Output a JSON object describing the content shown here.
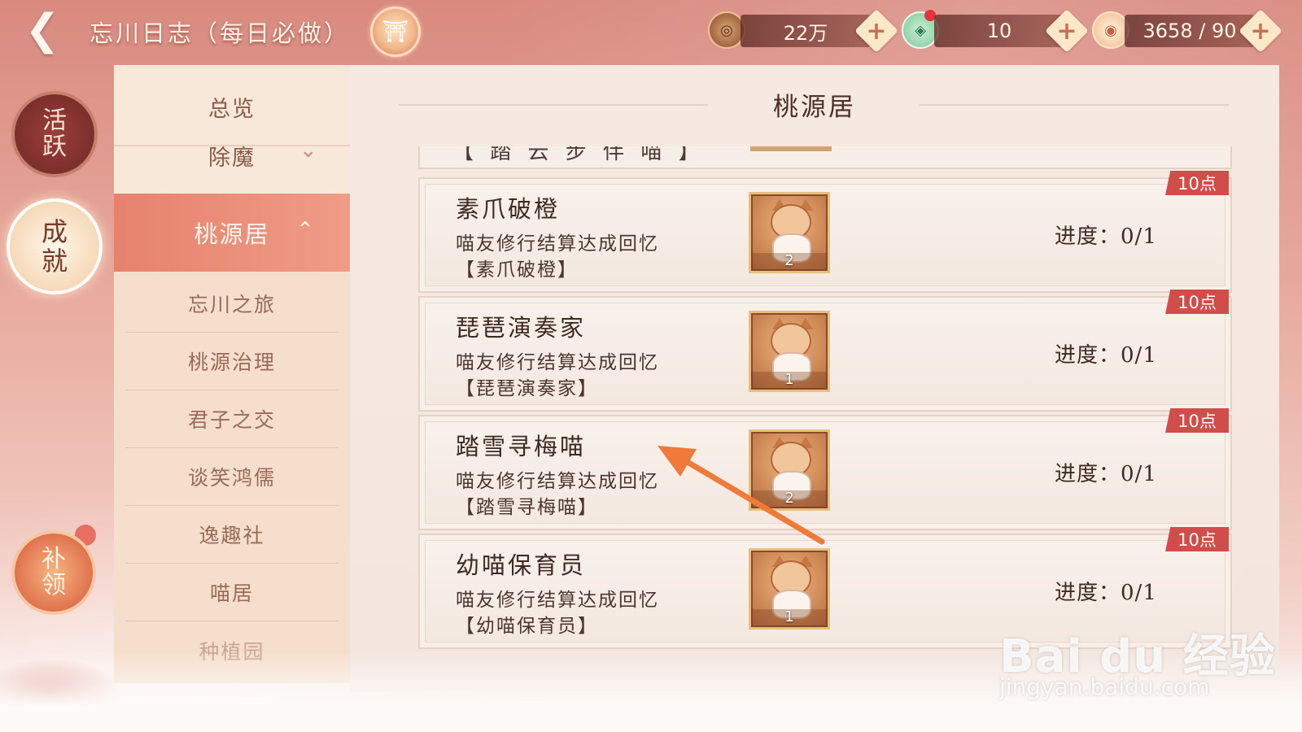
{
  "header": {
    "back_icon": "back-arrow-icon",
    "title": "忘川日志（每日必做）",
    "emblem_icon": "pavilion-emblem-icon"
  },
  "resources": [
    {
      "icon": "copper-coin-icon",
      "value": "22万"
    },
    {
      "icon": "jade-token-icon",
      "value": "10"
    },
    {
      "icon": "rice-bowl-icon",
      "value": "3658 / 90"
    }
  ],
  "side_tabs": {
    "active": "活跃",
    "achievement": "成就",
    "claim": "补领"
  },
  "nav": {
    "overview": "总览",
    "exorcism": "除魔",
    "selected": "桃源居",
    "sub_items": [
      "忘川之旅",
      "桃源治理",
      "君子之交",
      "谈笑鸿儒",
      "逸趣社",
      "喵居",
      "种植园"
    ]
  },
  "content": {
    "title": "桃源居",
    "clipped_row_text": "【 踏 云 步 伴 喵 】",
    "progress_label": "进度：",
    "tasks": [
      {
        "name": "素爪破橙",
        "desc": "喵友修行结算达成回忆",
        "bracket": "【素爪破橙】",
        "reward_count": "2",
        "progress": "0/1",
        "points": "10点"
      },
      {
        "name": "琵琶演奏家",
        "desc": "喵友修行结算达成回忆",
        "bracket": "【琵琶演奏家】",
        "reward_count": "1",
        "progress": "0/1",
        "points": "10点"
      },
      {
        "name": "踏雪寻梅喵",
        "desc": "喵友修行结算达成回忆",
        "bracket": "【踏雪寻梅喵】",
        "reward_count": "2",
        "progress": "0/1",
        "points": "10点"
      },
      {
        "name": "幼喵保育员",
        "desc": "喵友修行结算达成回忆",
        "bracket": "【幼喵保育员】",
        "reward_count": "1",
        "progress": "0/1",
        "points": "10点"
      }
    ]
  },
  "watermark": {
    "main": "Bai du 经验",
    "sub": "jingyan.baidu.com"
  },
  "colors": {
    "accent": "#e6826d",
    "points_badge": "#d14d4a",
    "annotation_arrow": "#f07a3a"
  }
}
